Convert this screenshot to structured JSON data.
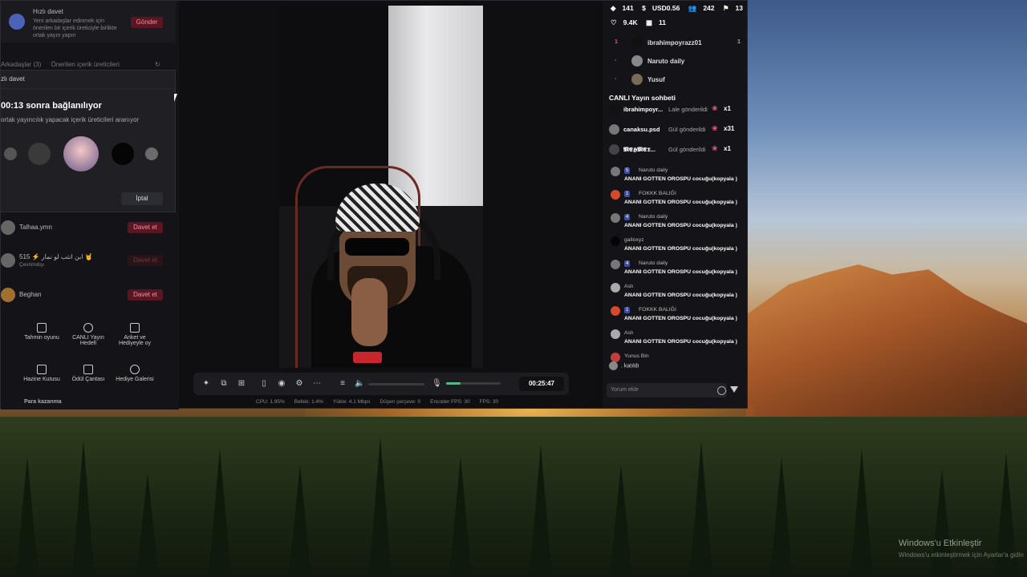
{
  "left_panel": {
    "quick_invite": {
      "title": "Hızlı davet",
      "desc": "Yeni arkadaşlar edinmek için önerilen bir içerik üreticiyle birlikte ortak yayın yapın",
      "send_label": "Gönder"
    },
    "tabs": [
      "Arkadaşlar (3)",
      "Önerilen içerik üreticileri"
    ],
    "modal": {
      "header": "zlı davet",
      "timer": "00:13 sonra bağlanılıyor",
      "subtitle": "ortak yayıncılık yapacak içerik üreticileri aranıyor",
      "cancel_label": "İptal"
    },
    "friends": [
      {
        "name": "Talhaa.ymn",
        "action": "Davet et",
        "status": ""
      },
      {
        "name": "515 ⚡ ابن انتب لو نمار 🤘",
        "action": "Davet et",
        "status": "Çevrimdışı"
      },
      {
        "name": "Beghan",
        "action": "Davet et",
        "status": ""
      }
    ],
    "tools": [
      "Tahmin oyunu",
      "CANLI Yayın Hedefi",
      "Anket ve Hediyeyle oy",
      "Hazine Kutusu",
      "Ödül Çantası",
      "Hediye Galerisi"
    ],
    "footer": "Para kazanma"
  },
  "controls": {
    "timer": "00:25:47",
    "mic_level": 0.27,
    "stats": [
      "CPU: 1.95%",
      "Bellek: 1.4%",
      "Yükle: 4.1 Mbps",
      "Düşen çerçeve: 0",
      "Encoder FPS: 30",
      "FPS: 30"
    ]
  },
  "right_panel": {
    "top_stats": [
      "141",
      "USD0.56",
      "242",
      "13",
      "9.4K",
      "11"
    ],
    "ranking": [
      {
        "rank": "1",
        "name": "ibrahimpoyrazz01",
        "count": "1"
      },
      {
        "rank": "-",
        "name": "Naruto daily",
        "count": ""
      },
      {
        "rank": "-",
        "name": "Yusuf",
        "count": ""
      }
    ],
    "chat_title": "CANLI Yayın sohbeti",
    "gifts": [
      {
        "user": "ibrahimpoyr...",
        "text": "Lale gönderildi",
        "mult": "x1"
      },
      {
        "user": "canaksu.psd",
        "text": "Gül gönderildi",
        "mult": "x31"
      },
      {
        "user": "𝕸𝕰𝕳𝕸𝕰𝕿...",
        "text": "Gül gönderildi",
        "mult": "x1"
      }
    ],
    "messages": [
      {
        "badge": "5",
        "user": "Naruto daily",
        "text": "ANANI GOTTEN OROSPU cocuğu(kopyala )"
      },
      {
        "badge": "1",
        "user": "FOKKK BALIĞI",
        "text": "ANANI GOTTEN OROSPU cocuğu(kopyala )"
      },
      {
        "badge": "4",
        "user": "Naruto daily",
        "text": "ANANI GOTTEN OROSPU cocuğu(kopyala )"
      },
      {
        "badge": "",
        "user": "galloxyz",
        "text": "ANANI GOTTEN OROSPU cocuğu(kopyala )"
      },
      {
        "badge": "4",
        "user": "Naruto daily",
        "text": "ANANI GOTTEN OROSPU cocuğu(kopyala )"
      },
      {
        "badge": "",
        "user": "Aslı",
        "text": "ANANI GOTTEN OROSPU cocuğu(kopyala )"
      },
      {
        "badge": "1",
        "user": "FOKKK BALIĞI",
        "text": "ANANI GOTTEN OROSPU cocuğu(kopyala )"
      },
      {
        "badge": "",
        "user": "Aslı",
        "text": "ANANI GOTTEN OROSPU cocuğu(kopyala )"
      }
    ],
    "last_user": "Yunus Bin",
    "joined": ". katıldı",
    "comment_placeholder": "Yorum ekle"
  },
  "desktop": {
    "watermark_title": "Windows'u Etkinleştir",
    "watermark_sub": "Windows'u etkinleştirmek için Ayarlar'a gidin"
  },
  "colors": {
    "accent_red": "#ff4d6d",
    "mic_green": "#27d47a",
    "badge_blue": "#3f4fa0"
  }
}
